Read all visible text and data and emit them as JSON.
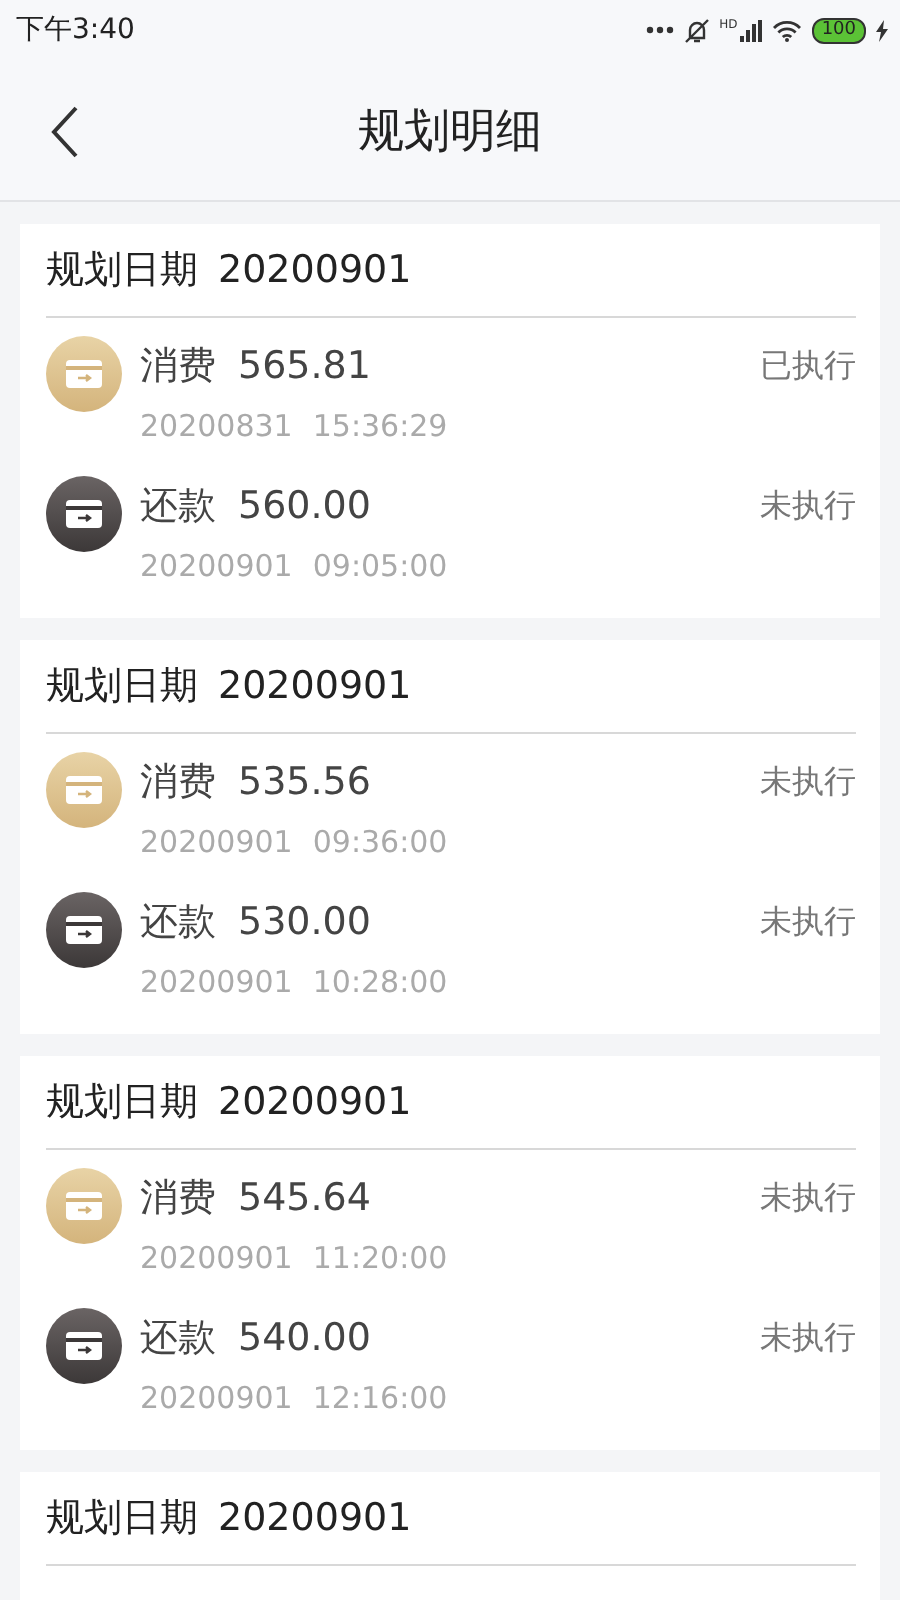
{
  "status_bar": {
    "time": "下午3:40",
    "signal_label": "HD",
    "battery": "100"
  },
  "header": {
    "title": "规划明细"
  },
  "cards": [
    {
      "label": "规划日期",
      "date": "20200901",
      "entries": [
        {
          "kind": "consume",
          "type": "消费",
          "amount": "565.81",
          "status": "已执行",
          "date": "20200831",
          "time": "15:36:29"
        },
        {
          "kind": "repay",
          "type": "还款",
          "amount": "560.00",
          "status": "未执行",
          "date": "20200901",
          "time": "09:05:00"
        }
      ]
    },
    {
      "label": "规划日期",
      "date": "20200901",
      "entries": [
        {
          "kind": "consume",
          "type": "消费",
          "amount": "535.56",
          "status": "未执行",
          "date": "20200901",
          "time": "09:36:00"
        },
        {
          "kind": "repay",
          "type": "还款",
          "amount": "530.00",
          "status": "未执行",
          "date": "20200901",
          "time": "10:28:00"
        }
      ]
    },
    {
      "label": "规划日期",
      "date": "20200901",
      "entries": [
        {
          "kind": "consume",
          "type": "消费",
          "amount": "545.64",
          "status": "未执行",
          "date": "20200901",
          "time": "11:20:00"
        },
        {
          "kind": "repay",
          "type": "还款",
          "amount": "540.00",
          "status": "未执行",
          "date": "20200901",
          "time": "12:16:00"
        }
      ]
    },
    {
      "label": "规划日期",
      "date": "20200901"
    }
  ]
}
